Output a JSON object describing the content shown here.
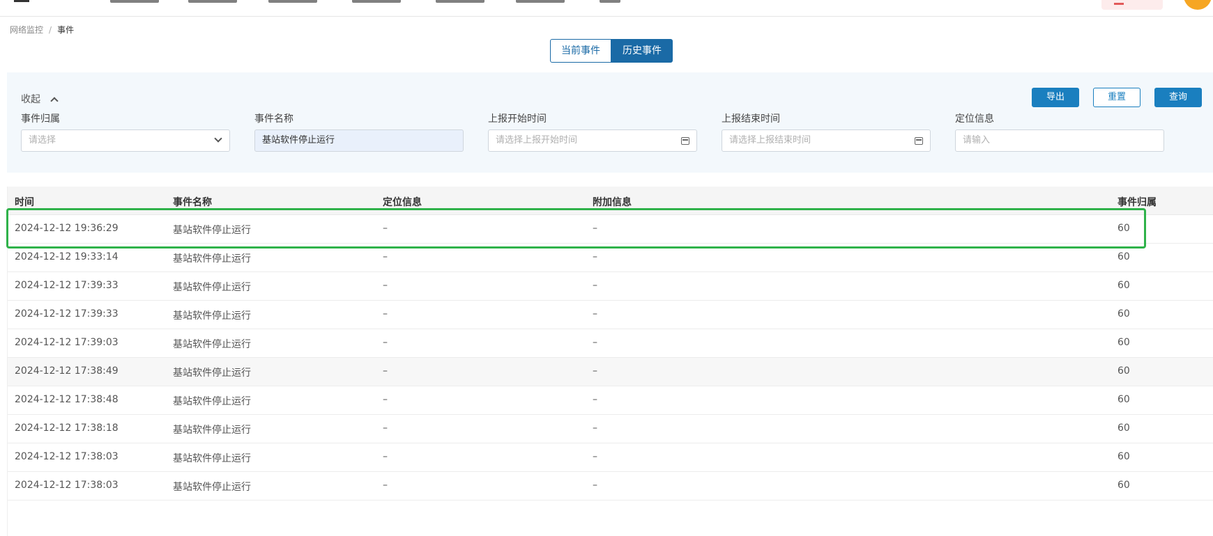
{
  "breadcrumb": {
    "parent": "网络监控",
    "current": "事件"
  },
  "tabs": {
    "current": "当前事件",
    "history": "历史事件"
  },
  "filter": {
    "collapse_label": "收起",
    "buttons": {
      "export": "导出",
      "reset": "重置",
      "query": "查询"
    },
    "fields": [
      {
        "label": "事件归属",
        "placeholder": "请选择",
        "value": ""
      },
      {
        "label": "事件名称",
        "placeholder": "",
        "value": "基站软件停止运行"
      },
      {
        "label": "上报开始时间",
        "placeholder": "请选择上报开始时间",
        "value": ""
      },
      {
        "label": "上报结束时间",
        "placeholder": "请选择上报结束时间",
        "value": ""
      },
      {
        "label": "定位信息",
        "placeholder": "请输入",
        "value": ""
      }
    ]
  },
  "table": {
    "headers": [
      "时间",
      "事件名称",
      "定位信息",
      "附加信息",
      "事件归属"
    ],
    "rows": [
      [
        "2024-12-12 19:36:29",
        "基站软件停止运行",
        "–",
        "–",
        "60"
      ],
      [
        "2024-12-12 19:33:14",
        "基站软件停止运行",
        "–",
        "–",
        "60"
      ],
      [
        "2024-12-12 17:39:33",
        "基站软件停止运行",
        "–",
        "–",
        "60"
      ],
      [
        "2024-12-12 17:39:33",
        "基站软件停止运行",
        "–",
        "–",
        "60"
      ],
      [
        "2024-12-12 17:39:03",
        "基站软件停止运行",
        "–",
        "–",
        "60"
      ],
      [
        "2024-12-12 17:38:49",
        "基站软件停止运行",
        "–",
        "–",
        "60"
      ],
      [
        "2024-12-12 17:38:48",
        "基站软件停止运行",
        "–",
        "–",
        "60"
      ],
      [
        "2024-12-12 17:38:18",
        "基站软件停止运行",
        "–",
        "–",
        "60"
      ],
      [
        "2024-12-12 17:38:03",
        "基站软件停止运行",
        "–",
        "–",
        "60"
      ],
      [
        "2024-12-12 17:38:03",
        "基站软件停止运行",
        "–",
        "–",
        "60"
      ]
    ]
  },
  "colors": {
    "primary": "#1a7fbf",
    "tab_active": "#1a6aa6",
    "highlight": "#2fb24a",
    "avatar": "#f6a623"
  }
}
